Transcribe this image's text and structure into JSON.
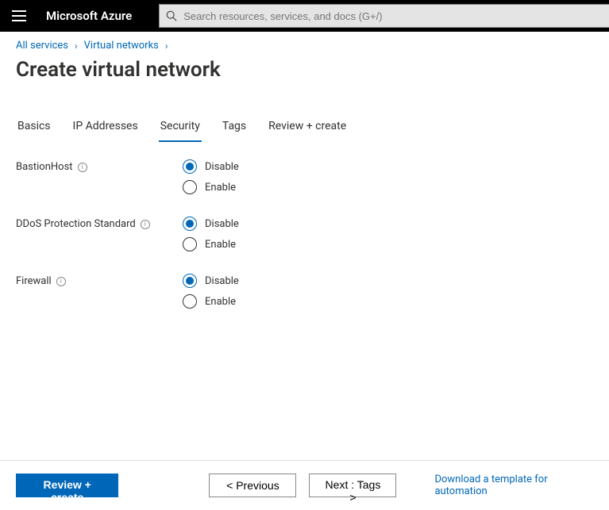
{
  "header": {
    "brand": "Microsoft Azure",
    "search_placeholder": "Search resources, services, and docs (G+/)"
  },
  "breadcrumb": {
    "items": [
      "All services",
      "Virtual networks"
    ]
  },
  "page": {
    "title": "Create virtual network"
  },
  "tabs": {
    "items": [
      "Basics",
      "IP Addresses",
      "Security",
      "Tags",
      "Review + create"
    ],
    "active_index": 2
  },
  "form": {
    "groups": [
      {
        "label": "BastionHost",
        "options": [
          "Disable",
          "Enable"
        ],
        "selected": 0
      },
      {
        "label": "DDoS Protection Standard",
        "options": [
          "Disable",
          "Enable"
        ],
        "selected": 0
      },
      {
        "label": "Firewall",
        "options": [
          "Disable",
          "Enable"
        ],
        "selected": 0
      }
    ]
  },
  "footer": {
    "primary": "Review + create",
    "previous": "< Previous",
    "next": "Next : Tags >",
    "template_link": "Download a template for automation"
  }
}
